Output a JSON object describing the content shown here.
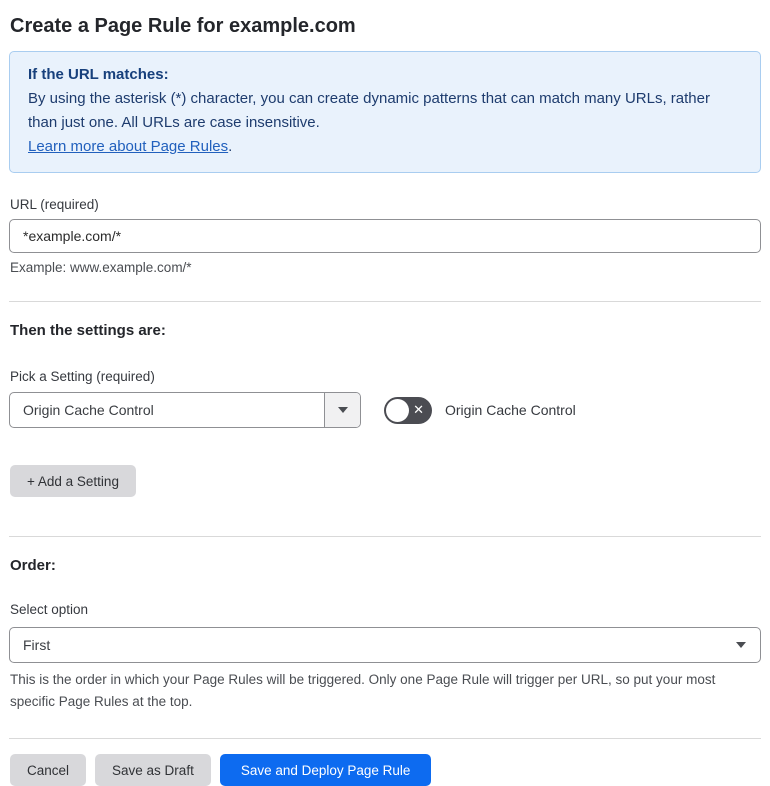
{
  "page": {
    "title": "Create a Page Rule for example.com"
  },
  "info_box": {
    "heading": "If the URL matches:",
    "body": "By using the asterisk (*) character, you can create dynamic patterns that can match many URLs, rather than just one. All URLs are case insensitive.",
    "link_text": "Learn more about Page Rules",
    "link_suffix": "."
  },
  "url_field": {
    "label": "URL (required)",
    "value": "*example.com/*",
    "helper": "Example: www.example.com/*"
  },
  "settings_section": {
    "heading": "Then the settings are:",
    "picker_label": "Pick a Setting (required)",
    "picker_value": "Origin Cache Control",
    "toggle_state": "off",
    "toggle_icon": "x-icon",
    "toggle_x_glyph": "✕",
    "toggle_label": "Origin Cache Control",
    "add_button_label": "+ Add a Setting"
  },
  "order_section": {
    "heading": "Order:",
    "select_label": "Select option",
    "select_value": "First",
    "helper": "This is the order in which your Page Rules will be triggered. Only one Page Rule will trigger per URL, so put your most specific Page Rules at the top."
  },
  "footer": {
    "cancel_label": "Cancel",
    "save_draft_label": "Save as Draft",
    "save_deploy_label": "Save and Deploy Page Rule"
  },
  "colors": {
    "accent_blue": "#0d6bf0",
    "info_box_bg": "#e9f2fc",
    "info_box_border": "#a9cdf0",
    "info_text": "#1e3c6e",
    "link_blue": "#2160bd",
    "toggle_bg": "#4b4c52",
    "divider": "#d9d9d9",
    "gray_button_bg": "#d8d8db"
  }
}
